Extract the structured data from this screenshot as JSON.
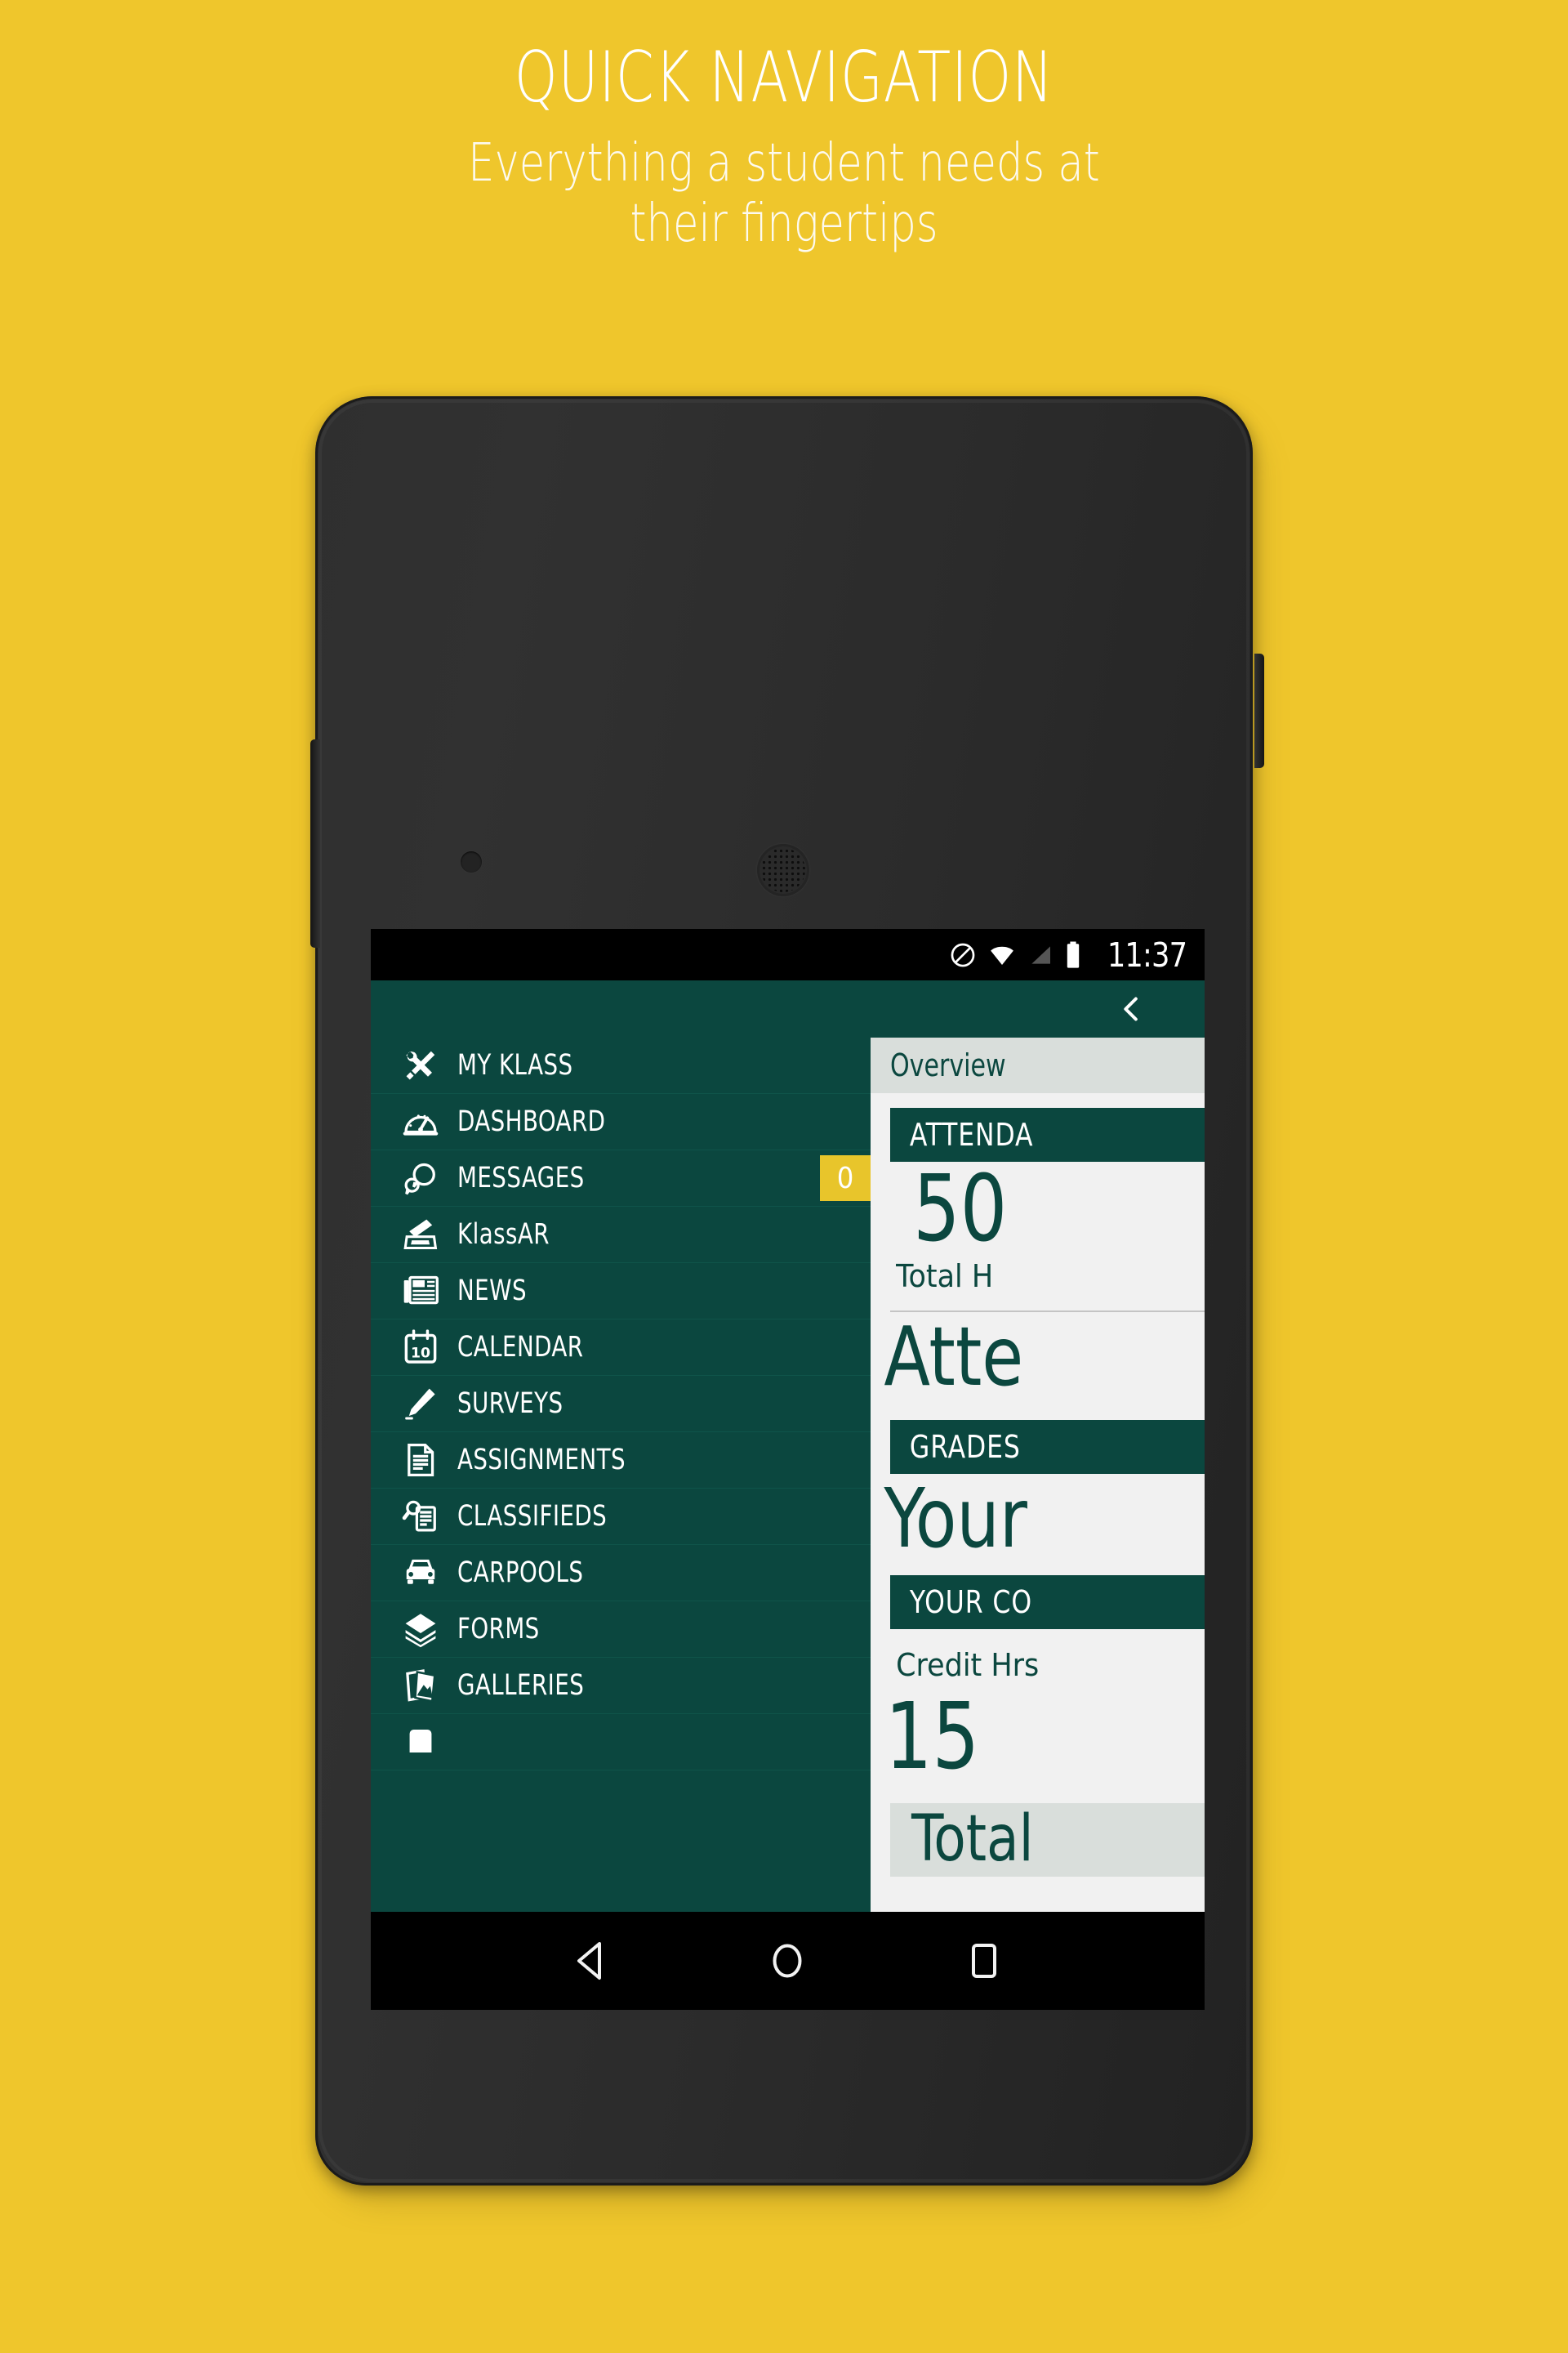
{
  "promo": {
    "title": "QUICK NAVIGATION",
    "subtitle": "Everything a student needs at\ntheir fingertips"
  },
  "theme": {
    "background": "#efc62c",
    "primary_teal": "#0b473f",
    "accent_yellow": "#e8c52b",
    "panel_bg": "#f1f1f1",
    "tab_bg": "#d9dedb"
  },
  "status_bar": {
    "time": "11:37",
    "icons": [
      "do-not-disturb-icon",
      "wifi-icon",
      "cellular-signal-icon",
      "battery-icon"
    ]
  },
  "toolbar": {
    "back_icon": "chevron-left-icon"
  },
  "drawer": {
    "items": [
      {
        "label": "MY KLASS",
        "icon": "tools-icon",
        "badge": null
      },
      {
        "label": "DASHBOARD",
        "icon": "gauge-icon",
        "badge": null
      },
      {
        "label": "MESSAGES",
        "icon": "chat-icon",
        "badge": "0"
      },
      {
        "label": "KlassAR",
        "icon": "scanner-icon",
        "badge": null
      },
      {
        "label": "NEWS",
        "icon": "newspaper-icon",
        "badge": null
      },
      {
        "label": "CALENDAR",
        "icon": "calendar-icon",
        "badge": null
      },
      {
        "label": "SURVEYS",
        "icon": "pencil-icon",
        "badge": null
      },
      {
        "label": "ASSIGNMENTS",
        "icon": "document-icon",
        "badge": null
      },
      {
        "label": "CLASSIFIEDS",
        "icon": "classifieds-icon",
        "badge": null
      },
      {
        "label": "CARPOOLS",
        "icon": "car-icon",
        "badge": null
      },
      {
        "label": "FORMS",
        "icon": "layers-icon",
        "badge": null
      },
      {
        "label": "GALLERIES",
        "icon": "photos-icon",
        "badge": null
      },
      {
        "label": "",
        "icon": "partial-icon",
        "badge": null
      }
    ]
  },
  "content": {
    "tab_label": "Overview",
    "attendance_badge": "ATTENDA",
    "attendance_value": "50",
    "attendance_caption": "Total H",
    "attendance_headline": "Atte",
    "grades_badge": "GRADES",
    "grades_headline": "Your",
    "courses_badge": "YOUR CO",
    "courses_caption": "Credit Hrs",
    "courses_value": "15",
    "total_headline": "Total"
  },
  "android_nav": {
    "back": "back-triangle-icon",
    "home": "home-circle-icon",
    "recents": "recents-square-icon"
  }
}
